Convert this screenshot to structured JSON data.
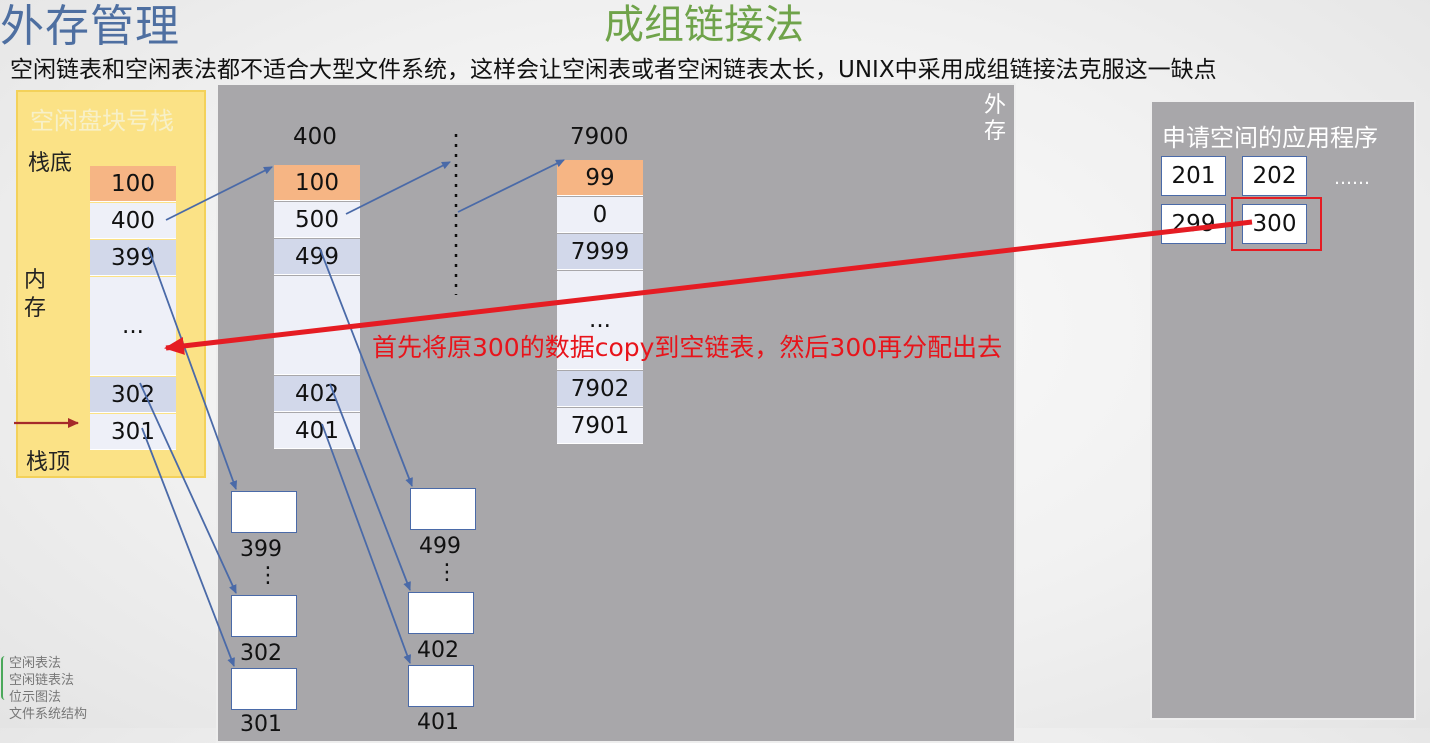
{
  "header": {
    "section_title": "外存管理",
    "topic_title": "成组链接法",
    "subtitle": "空闲链表和空闲表法都不适合大型文件系统，这样会让空闲表或者空闲链表太长，UNIX中采用成组链接法克服这一缺点"
  },
  "memory": {
    "title": "空闲盘块号栈",
    "bottom_label": "栈底",
    "side_label_1": "内",
    "side_label_2": "存",
    "top_label": "栈顶",
    "cells": [
      "100",
      "400",
      "399",
      "...",
      "302",
      "301"
    ]
  },
  "disk": {
    "label_1": "外",
    "label_2": "存",
    "group1": {
      "head": "400",
      "cells": [
        "100",
        "500",
        "499",
        "...",
        "402",
        "401"
      ]
    },
    "vdots": "⋮",
    "group2": {
      "head": "7900",
      "cells": [
        "99",
        "0",
        "7999",
        "...",
        "7902",
        "7901"
      ]
    },
    "blocks_a": [
      "399",
      "302",
      "301"
    ],
    "blocks_b": [
      "499",
      "402",
      "401"
    ]
  },
  "app": {
    "title": "申请空间的应用程序",
    "boxes": [
      "201",
      "202",
      "299",
      "300"
    ],
    "ellipsis": "……"
  },
  "annotation": "首先将原300的数据copy到空链表，然后300再分配出去",
  "toc": [
    "空闲表法",
    "空闲链表法",
    "位示图法",
    "文件系统结构"
  ],
  "colors": {
    "arrow_blue": "#4a6aa8",
    "arrow_red": "#e51c23",
    "stack_top_arrow": "#a52a2a",
    "highlight": "#f6b584"
  }
}
